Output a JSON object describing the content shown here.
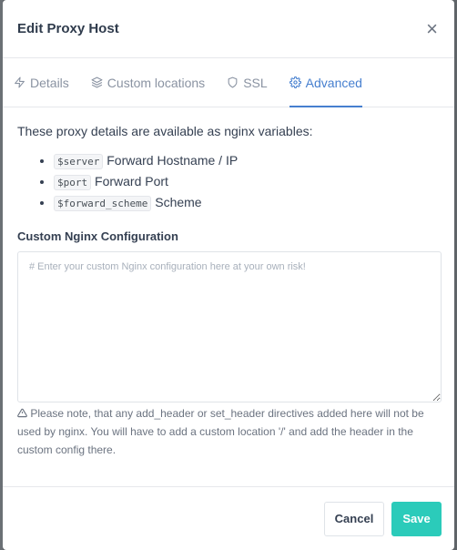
{
  "dialog": {
    "title": "Edit Proxy Host",
    "close_glyph": "×"
  },
  "tabs": [
    {
      "label": "Details",
      "icon": "zap-icon",
      "active": false
    },
    {
      "label": "Custom locations",
      "icon": "layers-icon",
      "active": false
    },
    {
      "label": "SSL",
      "icon": "shield-icon",
      "active": false
    },
    {
      "label": "Advanced",
      "icon": "gear-icon",
      "active": true
    }
  ],
  "advanced": {
    "intro": "These proxy details are available as nginx variables:",
    "variables": [
      {
        "code": "$server",
        "desc": "Forward Hostname / IP"
      },
      {
        "code": "$port",
        "desc": "Forward Port"
      },
      {
        "code": "$forward_scheme",
        "desc": "Scheme"
      }
    ],
    "config_label": "Custom Nginx Configuration",
    "config_placeholder": "# Enter your custom Nginx configuration here at your own risk!",
    "config_value": "",
    "note": "Please note, that any add_header or set_header directives added here will not be used by nginx. You will have to add a custom location '/' and add the header in the custom config there."
  },
  "footer": {
    "cancel_label": "Cancel",
    "save_label": "Save"
  },
  "colors": {
    "accent": "#467fcf",
    "save": "#2bcbba"
  }
}
